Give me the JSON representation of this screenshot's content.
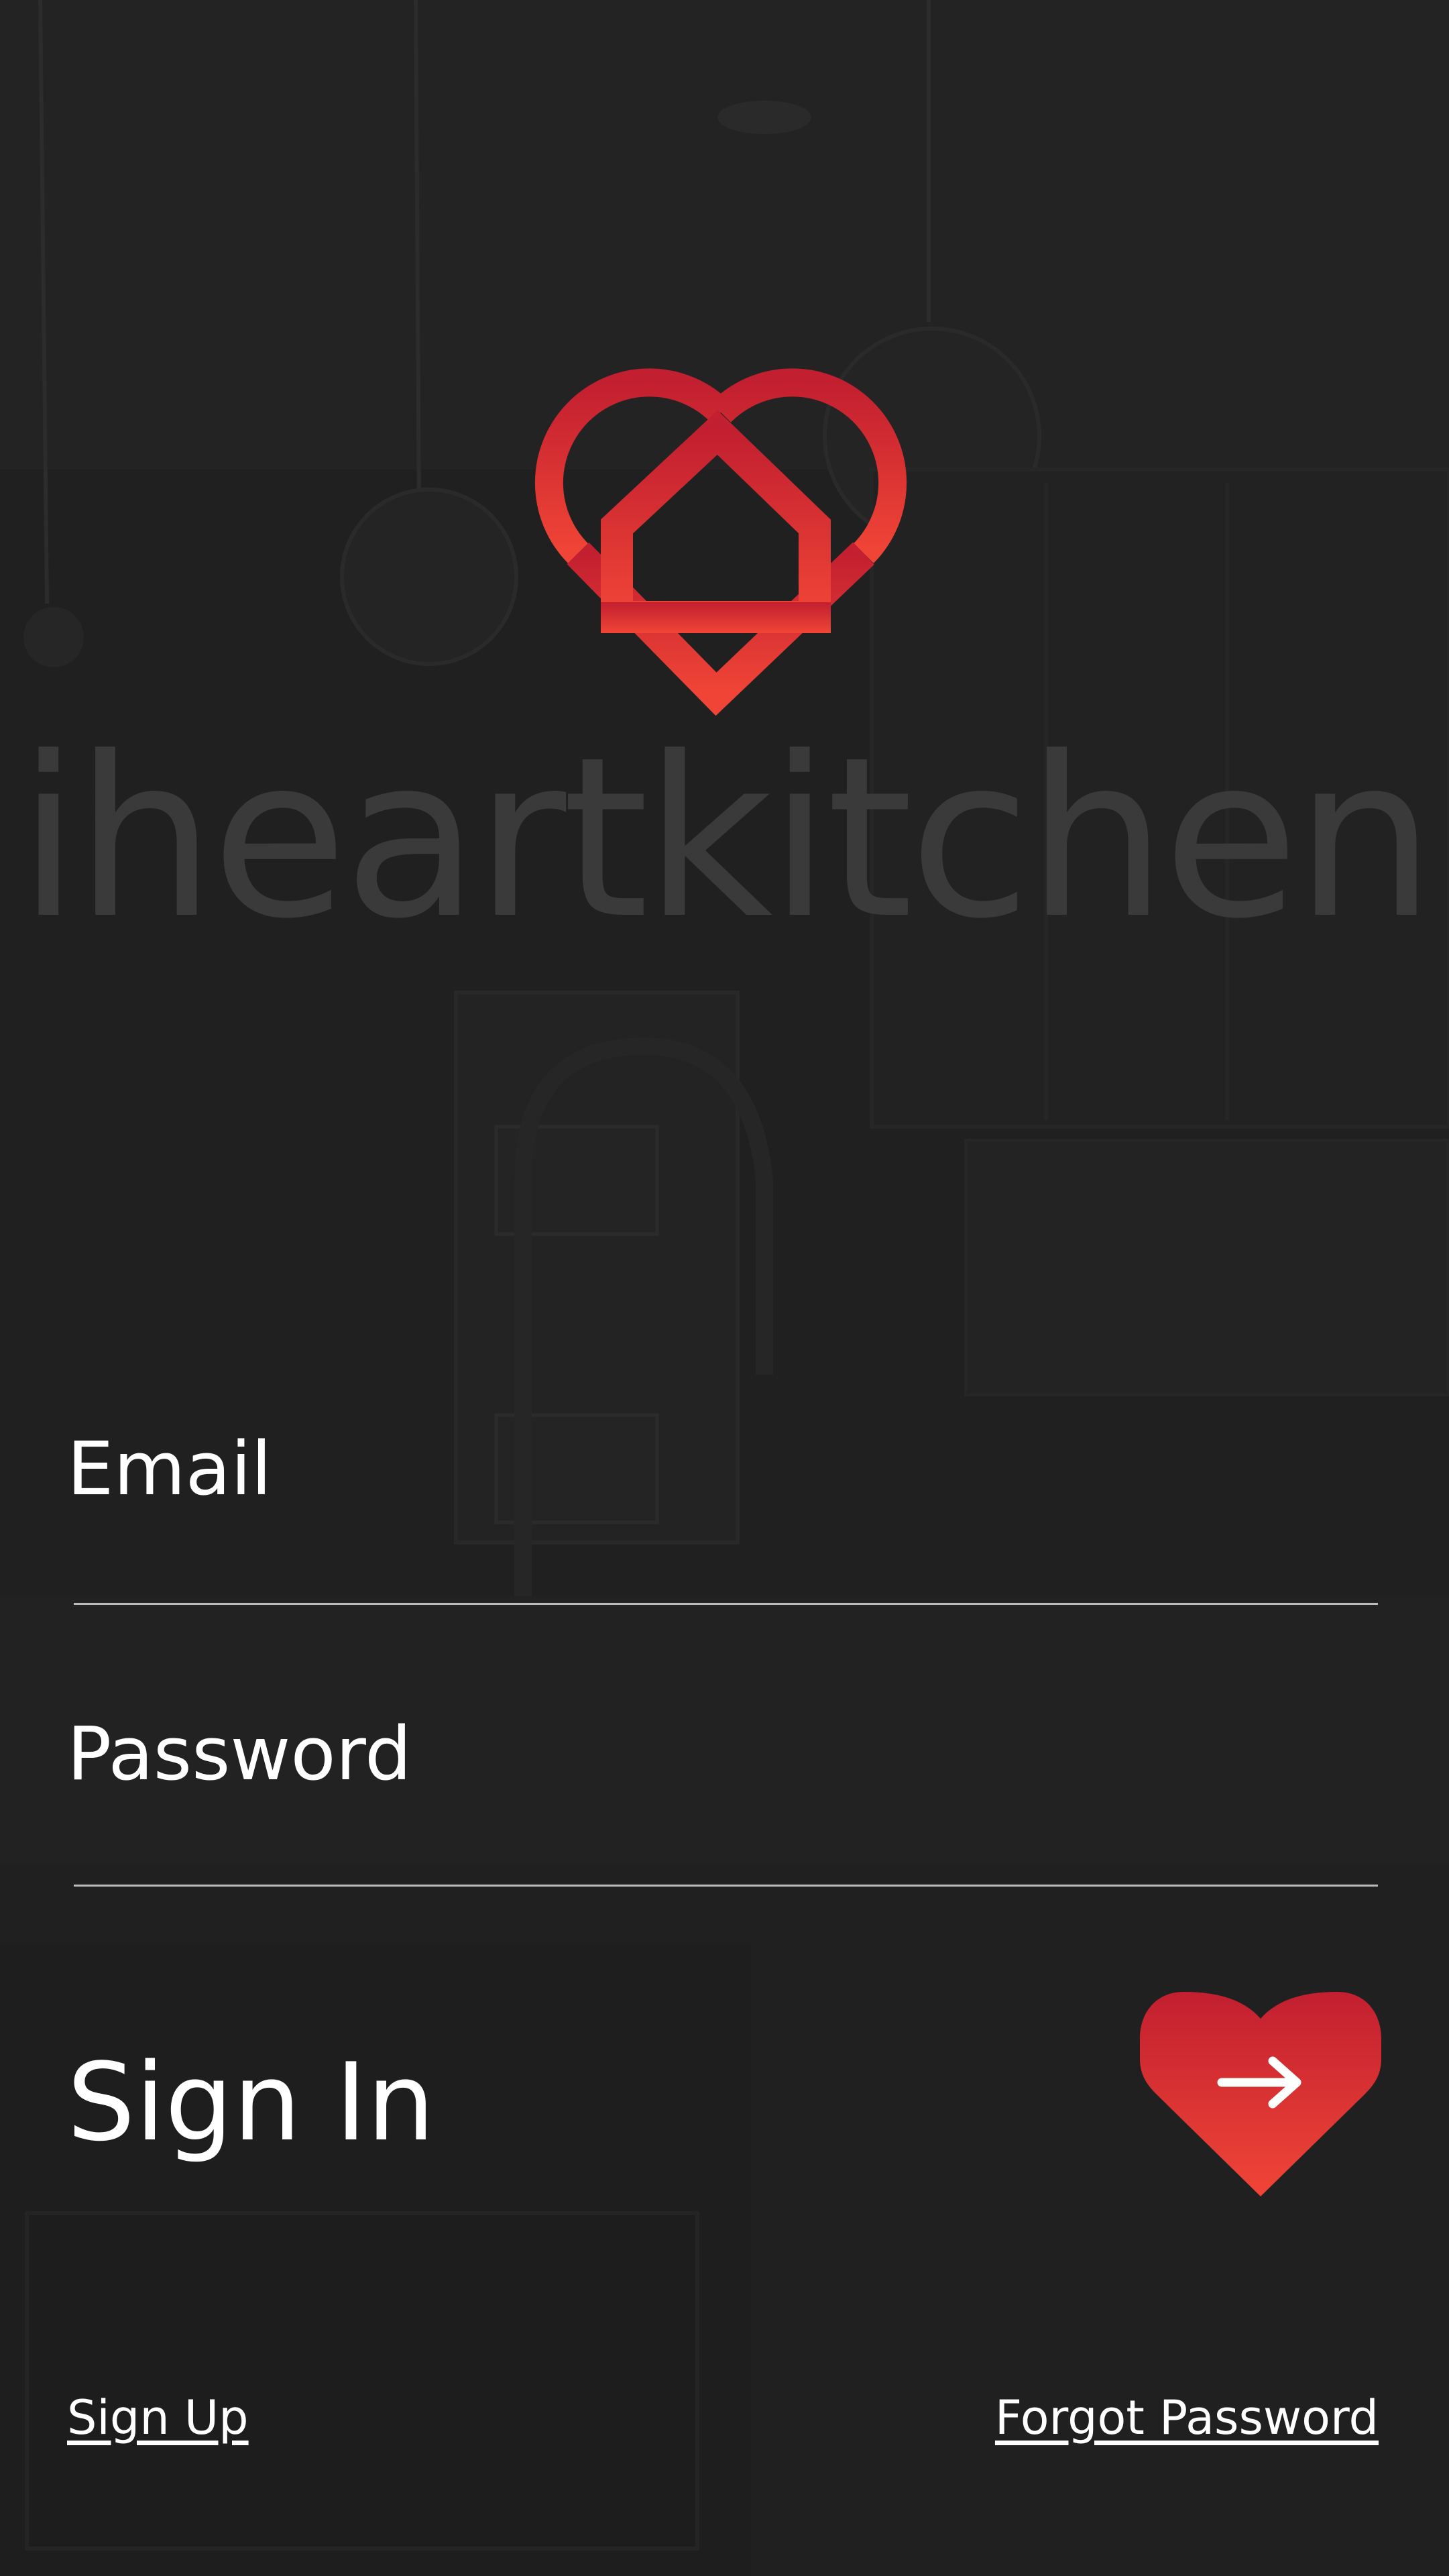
{
  "brand": {
    "name": "iheartkitchen",
    "accent_top": "#c21f30",
    "accent_bottom": "#f04536",
    "logo_icon": "heart-house-icon"
  },
  "form": {
    "email_placeholder": "Email",
    "password_placeholder": "Password",
    "title": "Sign In",
    "submit_icon": "arrow-right-icon"
  },
  "footer": {
    "sign_up": "Sign Up",
    "forgot_password": "Forgot Password"
  },
  "colors": {
    "background": "#212121",
    "text": "#ffffff",
    "brand_name_text": "#3a3a3a",
    "field_line": "#bdbdbd"
  }
}
